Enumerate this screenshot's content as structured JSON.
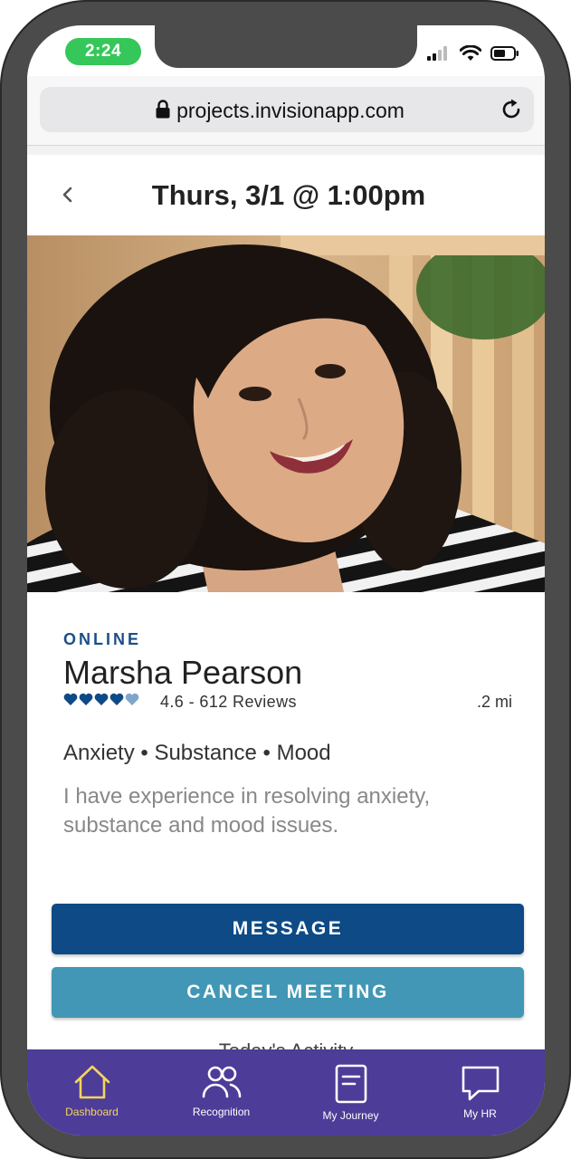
{
  "status_bar": {
    "time": "2:24"
  },
  "browser": {
    "url": "projects.invisionapp.com"
  },
  "header": {
    "back_icon": "chevron-left-icon",
    "title": "Thurs, 3/1 @ 1:00pm"
  },
  "profile": {
    "status": "ONLINE",
    "name": "Marsha Pearson",
    "rating": {
      "filled_hearts": 4,
      "total_hearts": 5
    },
    "rating_text": "4.6 - 612 Reviews",
    "distance": ".2 mi",
    "specialties": "Anxiety • Substance • Mood",
    "description": "I have experience in resolving anxiety, substance and mood issues."
  },
  "actions": {
    "message_label": "MESSAGE",
    "cancel_label": "CANCEL MEETING"
  },
  "peek_text": "Today's Activity",
  "tabbar": {
    "items": [
      {
        "label": "Dashboard",
        "icon": "home-icon",
        "active": true
      },
      {
        "label": "Recognition",
        "icon": "people-icon",
        "active": false
      },
      {
        "label": "My Journey",
        "icon": "journal-icon",
        "active": false
      },
      {
        "label": "My HR",
        "icon": "chat-bubble-icon",
        "active": false
      }
    ]
  },
  "colors": {
    "status_pill": "#35c759",
    "online_text": "#1d4f86",
    "heart_filled": "#0d4a86",
    "heart_light": "#7fa6c9",
    "message_button": "#0d4a86",
    "cancel_button": "#4197b5",
    "tabbar": "#4d3c98",
    "active_tab": "#f4d55b"
  }
}
